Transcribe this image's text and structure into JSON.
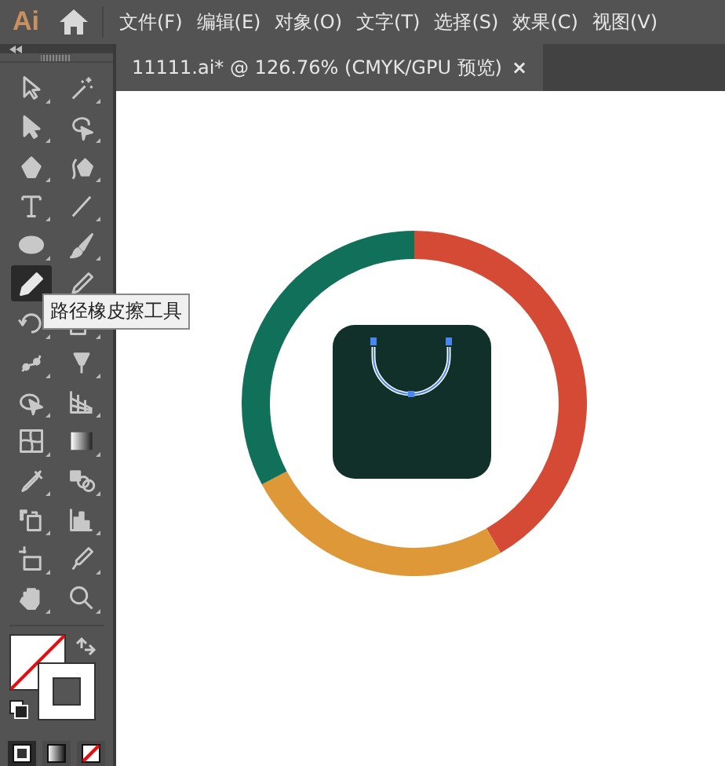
{
  "app": {
    "logo": "Ai"
  },
  "menu": [
    "文件(F)",
    "编辑(E)",
    "对象(O)",
    "文字(T)",
    "选择(S)",
    "效果(C)",
    "视图(V)"
  ],
  "document_tab": {
    "title": "11111.ai* @ 126.76% (CMYK/GPU 预览)",
    "close": "×"
  },
  "tools": [
    {
      "kind": "direct-select",
      "selected": false
    },
    {
      "kind": "magic-wand",
      "selected": false
    },
    {
      "kind": "select",
      "selected": false
    },
    {
      "kind": "lasso",
      "selected": false
    },
    {
      "kind": "pen",
      "selected": false
    },
    {
      "kind": "curvature",
      "selected": false
    },
    {
      "kind": "type",
      "selected": false
    },
    {
      "kind": "line",
      "selected": false
    },
    {
      "kind": "ellipse",
      "selected": false
    },
    {
      "kind": "brush",
      "selected": false
    },
    {
      "kind": "pencil",
      "selected": true
    },
    {
      "kind": "knife",
      "selected": false
    },
    {
      "kind": "rotate",
      "selected": false
    },
    {
      "kind": "scale",
      "selected": false
    },
    {
      "kind": "puppet",
      "selected": false
    },
    {
      "kind": "pin",
      "selected": false
    },
    {
      "kind": "shape-builder",
      "selected": false
    },
    {
      "kind": "perspective",
      "selected": false
    },
    {
      "kind": "mesh",
      "selected": false
    },
    {
      "kind": "gradient",
      "selected": false
    },
    {
      "kind": "eyedropper",
      "selected": false
    },
    {
      "kind": "blend",
      "selected": false
    },
    {
      "kind": "sprayer",
      "selected": false
    },
    {
      "kind": "graph",
      "selected": false
    },
    {
      "kind": "artboard",
      "selected": false
    },
    {
      "kind": "slice",
      "selected": false
    },
    {
      "kind": "hand",
      "selected": false
    },
    {
      "kind": "zoom",
      "selected": false
    }
  ],
  "tooltip": "路径橡皮擦工具",
  "draw_modes": [
    {
      "kind": "normal",
      "selected": true
    },
    {
      "kind": "gradient",
      "selected": false
    },
    {
      "kind": "none",
      "selected": false
    }
  ],
  "artwork": {
    "ring_segments": [
      {
        "color": "#d44a34"
      },
      {
        "color": "#de9838"
      },
      {
        "color": "#10705a"
      }
    ]
  }
}
